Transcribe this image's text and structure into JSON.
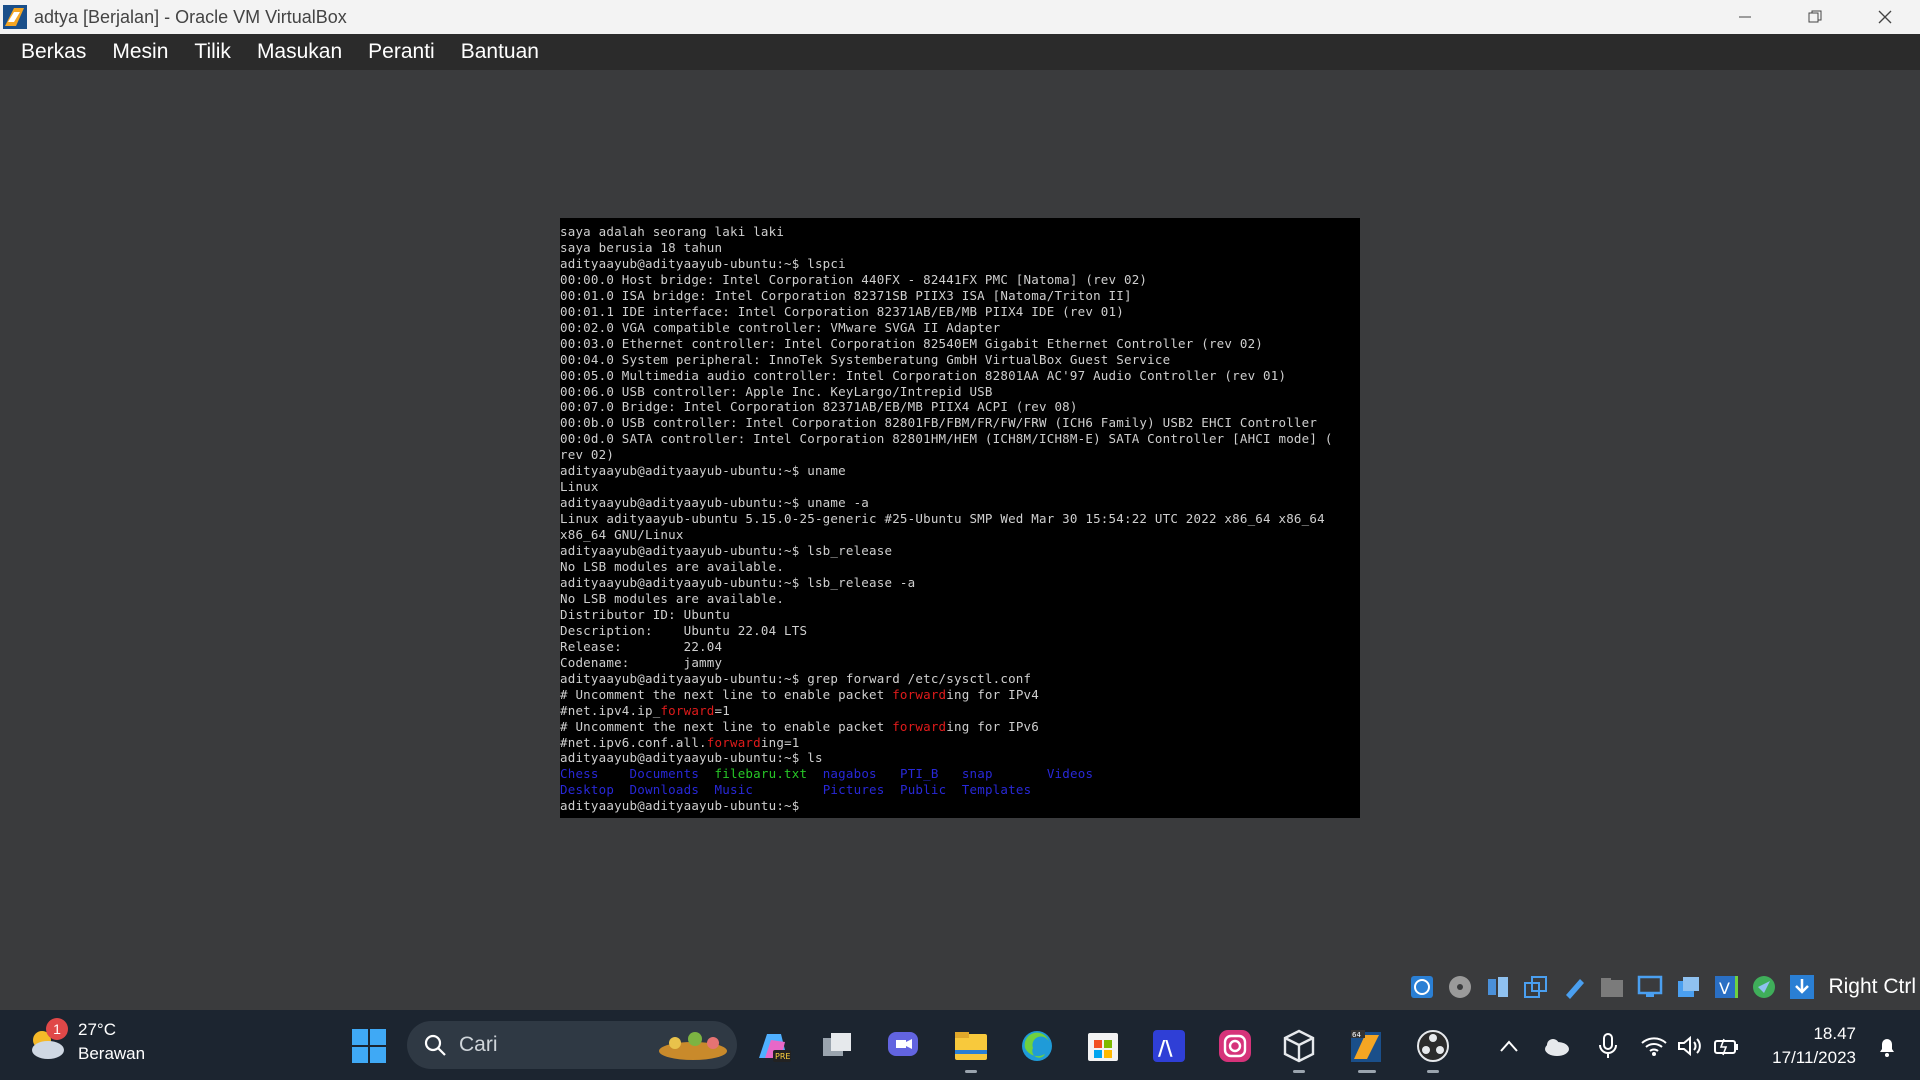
{
  "window": {
    "title": "adtya [Berjalan] - Oracle VM VirtualBox"
  },
  "menu": {
    "items": [
      "Berkas",
      "Mesin",
      "Tilik",
      "Masukan",
      "Peranti",
      "Bantuan"
    ]
  },
  "terminal": {
    "lines": [
      "saya adalah seorang laki laki",
      "saya berusia 18 tahun",
      "adityaayub@adityaayub-ubuntu:~$ lspci",
      "00:00.0 Host bridge: Intel Corporation 440FX - 82441FX PMC [Natoma] (rev 02)",
      "00:01.0 ISA bridge: Intel Corporation 82371SB PIIX3 ISA [Natoma/Triton II]",
      "00:01.1 IDE interface: Intel Corporation 82371AB/EB/MB PIIX4 IDE (rev 01)",
      "00:02.0 VGA compatible controller: VMware SVGA II Adapter",
      "00:03.0 Ethernet controller: Intel Corporation 82540EM Gigabit Ethernet Controller (rev 02)",
      "00:04.0 System peripheral: InnoTek Systemberatung GmbH VirtualBox Guest Service",
      "00:05.0 Multimedia audio controller: Intel Corporation 82801AA AC'97 Audio Controller (rev 01)",
      "00:06.0 USB controller: Apple Inc. KeyLargo/Intrepid USB",
      "00:07.0 Bridge: Intel Corporation 82371AB/EB/MB PIIX4 ACPI (rev 08)",
      "00:0b.0 USB controller: Intel Corporation 82801FB/FBM/FR/FW/FRW (ICH6 Family) USB2 EHCI Controller",
      "00:0d.0 SATA controller: Intel Corporation 82801HM/HEM (ICH8M/ICH8M-E) SATA Controller [AHCI mode] (",
      "rev 02)",
      "adityaayub@adityaayub-ubuntu:~$ uname",
      "Linux",
      "adityaayub@adityaayub-ubuntu:~$ uname -a",
      "Linux adityaayub-ubuntu 5.15.0-25-generic #25-Ubuntu SMP Wed Mar 30 15:54:22 UTC 2022 x86_64 x86_64",
      "x86_64 GNU/Linux",
      "adityaayub@adityaayub-ubuntu:~$ lsb_release",
      "No LSB modules are available.",
      "adityaayub@adityaayub-ubuntu:~$ lsb_release -a",
      "No LSB modules are available.",
      "Distributor ID: Ubuntu",
      "Description:    Ubuntu 22.04 LTS",
      "Release:        22.04",
      "Codename:       jammy",
      "adityaayub@adityaayub-ubuntu:~$ grep forward /etc/sysctl.conf"
    ],
    "grep_lines": [
      {
        "pre": "# Uncomment the next line to enable packet ",
        "match": "forward",
        "post": "ing for IPv4"
      },
      {
        "pre": "#net.ipv4.ip_",
        "match": "forward",
        "post": "=1"
      },
      {
        "pre": "# Uncomment the next line to enable packet ",
        "match": "forward",
        "post": "ing for IPv6"
      },
      {
        "pre": "#net.ipv6.conf.all.",
        "match": "forward",
        "post": "ing=1"
      }
    ],
    "ls_cmd": "adityaayub@adityaayub-ubuntu:~$ ls",
    "ls_row1": [
      "Chess",
      "Documents",
      "filebaru.txt",
      "nagabos",
      "PTI_B",
      "snap",
      "Videos"
    ],
    "ls_row2": [
      "Desktop",
      "Downloads",
      "Music",
      "Pictures",
      "Public",
      "Templates"
    ],
    "prompt": "adityaayub@adityaayub-ubuntu:~$"
  },
  "vbox_status": {
    "host_key": "Right Ctrl"
  },
  "taskbar": {
    "weather_temp": "27°C",
    "weather_cond": "Berawan",
    "weather_badge": "1",
    "search_placeholder": "Cari",
    "time": "18.47",
    "date": "17/11/2023"
  }
}
